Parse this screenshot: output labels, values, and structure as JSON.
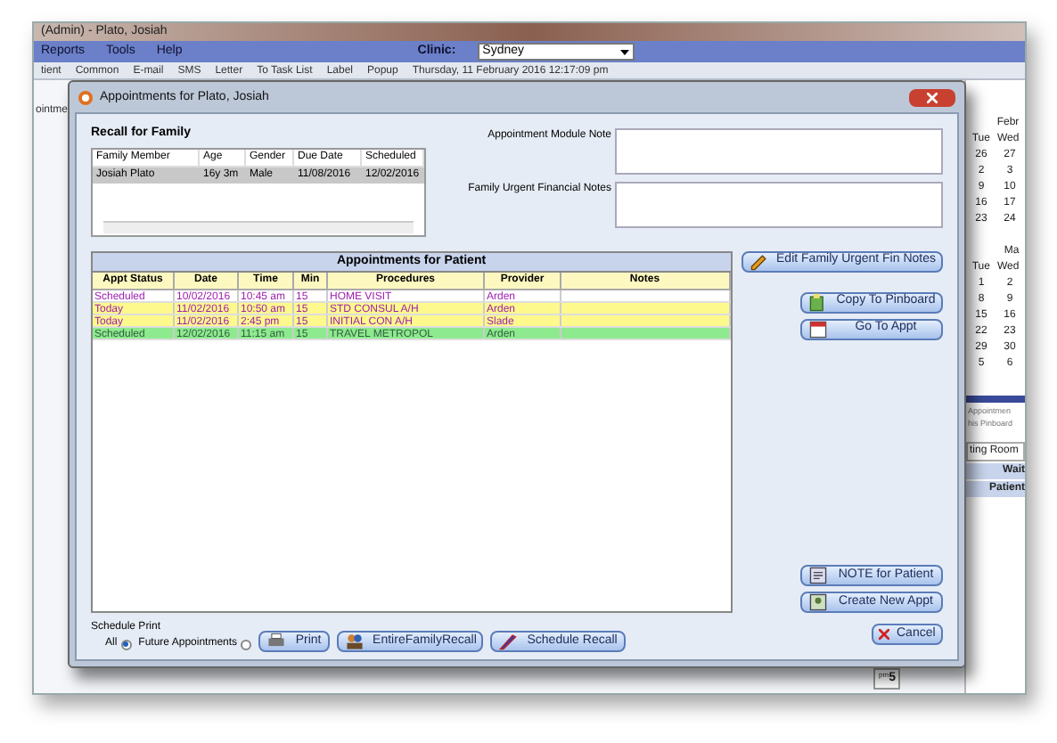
{
  "app": {
    "title": "(Admin) - Plato, Josiah",
    "menu": [
      "Reports",
      "Tools",
      "Help"
    ],
    "clinic_label": "Clinic:",
    "clinic_value": "Sydney",
    "toolbar": [
      "tient",
      "Common",
      "E-mail",
      "SMS",
      "Letter",
      "To Task List",
      "Label",
      "Popup"
    ],
    "datetime": "Thursday, 11 February 2016 12:17:09 pm",
    "left_cut": "ointme",
    "calendar": [
      {
        "month": "Febr",
        "header": [
          "Tue",
          "Wed"
        ],
        "rows": [
          [
            "26",
            "27"
          ],
          [
            "2",
            "3"
          ],
          [
            "9",
            "10"
          ],
          [
            "16",
            "17"
          ],
          [
            "23",
            "24"
          ]
        ]
      },
      {
        "month": "Ma",
        "header": [
          "Tue",
          "Wed"
        ],
        "rows": [
          [
            "1",
            "2"
          ],
          [
            "8",
            "9"
          ],
          [
            "15",
            "16"
          ],
          [
            "22",
            "23"
          ],
          [
            "29",
            "30"
          ],
          [
            "5",
            "6"
          ]
        ]
      }
    ],
    "pinboard_text": [
      "Appointmen",
      "his Pinboard"
    ],
    "waiting_room": "ting Room",
    "wait_header": "Wait",
    "patient_header": "Patient",
    "time_cell": {
      "ampm": "pm",
      "hour": "5"
    }
  },
  "dialog": {
    "title": "Appointments for Plato, Josiah",
    "recall": {
      "title": "Recall for Family",
      "columns": [
        "Family Member",
        "Age",
        "Gender",
        "Due Date",
        "Scheduled"
      ],
      "rows": [
        {
          "cells": [
            "Josiah  Plato",
            "16y 3m",
            "Male",
            "11/08/2016",
            "12/02/2016"
          ],
          "selected": true
        }
      ]
    },
    "notes": [
      {
        "label": "Appointment Module Note"
      },
      {
        "label": "Family Urgent Financial Notes"
      }
    ],
    "appointments": {
      "title": "Appointments for Patient",
      "columns": [
        "Appt Status",
        "Date",
        "Time",
        "Min",
        "Procedures",
        "Provider",
        "Notes"
      ],
      "rows": [
        {
          "cells": [
            "Scheduled",
            "10/02/2016",
            "10:45 am",
            "15",
            "HOME VISIT",
            "Arden",
            ""
          ],
          "color": "#ffffff",
          "kind": "standard"
        },
        {
          "cells": [
            "Today",
            "11/02/2016",
            "10:50 am",
            "15",
            "STD CONSUL A/H",
            "Arden",
            ""
          ],
          "color": "#fdf98c",
          "kind": "standard"
        },
        {
          "cells": [
            "Today",
            "11/02/2016",
            "2:45 pm",
            "15",
            "INITIAL CON A/H",
            "Slade",
            ""
          ],
          "color": "#fdf98c",
          "kind": "standard"
        },
        {
          "cells": [
            "Scheduled",
            "12/02/2016",
            "11:15 am",
            "15",
            "TRAVEL METROPOL",
            "Arden",
            ""
          ],
          "color": "#8eea8e",
          "kind": "highlighted"
        }
      ]
    },
    "side_buttons": [
      {
        "label": "Edit Family Urgent Fin Notes",
        "kind": "pencil"
      },
      {
        "label": "Copy To Pinboard",
        "kind": "copy"
      },
      {
        "label": "Go To Appt",
        "kind": "calendar"
      },
      {
        "label": "NOTE for Patient",
        "kind": "note"
      },
      {
        "label": "Create New Appt",
        "kind": "new"
      }
    ],
    "schedule_print": {
      "label": "Schedule Print",
      "options": [
        {
          "label": "All",
          "selected": true
        },
        {
          "label": "Future Appointments",
          "selected": false
        }
      ]
    },
    "bottom_buttons": [
      {
        "label": "Print",
        "kind": "print"
      },
      {
        "label": "EntireFamilyRecall",
        "kind": "people"
      },
      {
        "label": "Schedule Recall",
        "kind": "pen"
      }
    ],
    "cancel": "Cancel"
  }
}
